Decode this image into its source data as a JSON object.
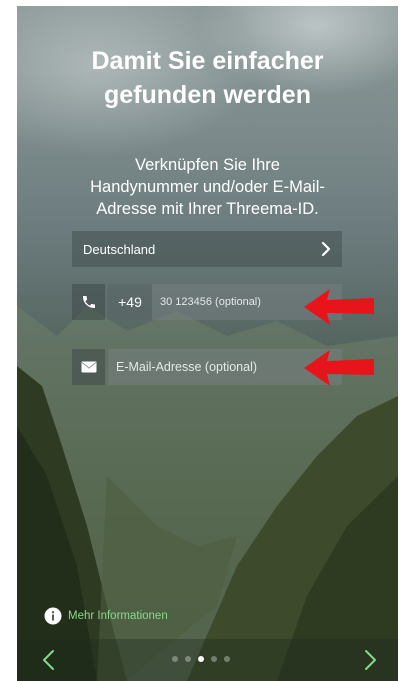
{
  "header": {
    "title": "Damit Sie einfacher\ngefunden werden",
    "subtitle": "Verknüpfen Sie Ihre\nHandynummer und/oder E-Mail-\nAdresse mit Ihrer Threema-ID."
  },
  "form": {
    "country": "Deutschland",
    "country_prefix": "+49",
    "phone_placeholder": "30 123456 (optional)",
    "email_placeholder": "E-Mail-Adresse (optional)"
  },
  "footer": {
    "more_info_label": "Mehr Informationen",
    "page_count": 5,
    "current_page_index": 2
  },
  "colors": {
    "accent_green": "#86d98a",
    "annotation_arrow_red": "#e8141c"
  },
  "icons": {
    "phone": "phone-icon",
    "email": "envelope-icon",
    "info": "info-icon",
    "country_chevron": "chevron-right-icon",
    "prev": "chevron-left-icon",
    "next": "chevron-right-icon"
  }
}
